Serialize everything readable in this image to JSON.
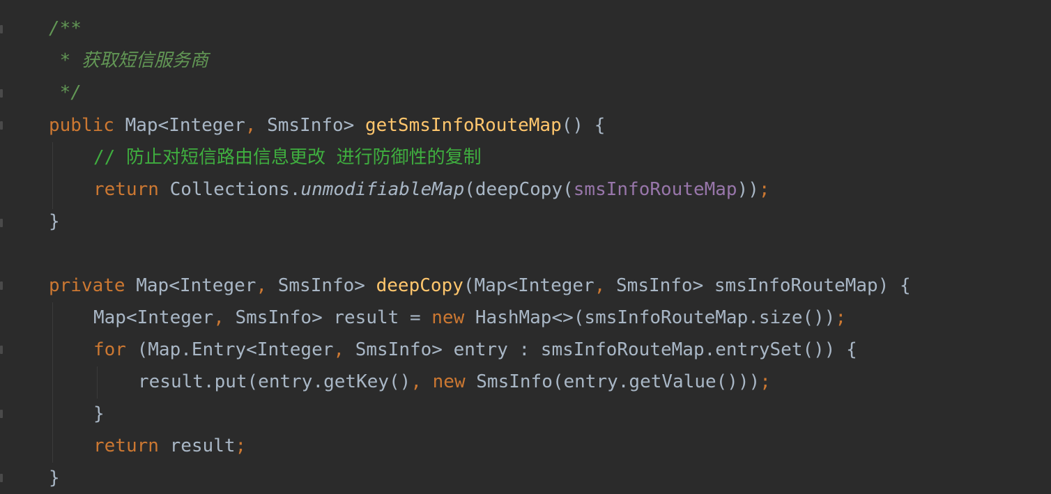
{
  "editor": {
    "lines": [
      {
        "segments": [
          {
            "text": "/**",
            "role": "doc-comment"
          }
        ]
      },
      {
        "segments": [
          {
            "text": " * 获取短信服务商",
            "role": "doc-comment"
          }
        ]
      },
      {
        "segments": [
          {
            "text": " */",
            "role": "doc-comment"
          }
        ]
      },
      {
        "segments": [
          {
            "text": "public",
            "role": "keyword"
          },
          {
            "text": " Map<Integer",
            "role": "plain"
          },
          {
            "text": ",",
            "role": "punct"
          },
          {
            "text": " SmsInfo> ",
            "role": "plain"
          },
          {
            "text": "getSmsInfoRouteMap",
            "role": "method"
          },
          {
            "text": "() {",
            "role": "plain"
          }
        ]
      },
      {
        "segments": [
          {
            "text": "// 防止对短信路由信息更改 进行防御性的复制",
            "role": "line-comment"
          }
        ]
      },
      {
        "segments": [
          {
            "text": "return",
            "role": "keyword"
          },
          {
            "text": " Collections.",
            "role": "plain"
          },
          {
            "text": "unmodifiableMap",
            "role": "static-call"
          },
          {
            "text": "(deepCopy(",
            "role": "plain"
          },
          {
            "text": "smsInfoRouteMap",
            "role": "field"
          },
          {
            "text": "))",
            "role": "plain"
          },
          {
            "text": ";",
            "role": "punct"
          }
        ]
      },
      {
        "segments": [
          {
            "text": "}",
            "role": "plain"
          }
        ]
      },
      {
        "segments": []
      },
      {
        "segments": [
          {
            "text": "private",
            "role": "keyword"
          },
          {
            "text": " Map<Integer",
            "role": "plain"
          },
          {
            "text": ",",
            "role": "punct"
          },
          {
            "text": " SmsInfo> ",
            "role": "plain"
          },
          {
            "text": "deepCopy",
            "role": "method"
          },
          {
            "text": "(Map<Integer",
            "role": "plain"
          },
          {
            "text": ",",
            "role": "punct"
          },
          {
            "text": " SmsInfo> smsInfoRouteMap) {",
            "role": "plain"
          }
        ]
      },
      {
        "segments": [
          {
            "text": "Map<Integer",
            "role": "plain"
          },
          {
            "text": ",",
            "role": "punct"
          },
          {
            "text": " SmsInfo> result = ",
            "role": "plain"
          },
          {
            "text": "new",
            "role": "keyword"
          },
          {
            "text": " HashMap<>(smsInfoRouteMap.size())",
            "role": "plain"
          },
          {
            "text": ";",
            "role": "punct"
          }
        ]
      },
      {
        "segments": [
          {
            "text": "for",
            "role": "keyword"
          },
          {
            "text": " (Map.Entry<Integer",
            "role": "plain"
          },
          {
            "text": ",",
            "role": "punct"
          },
          {
            "text": " SmsInfo> entry : smsInfoRouteMap.entrySet()) {",
            "role": "plain"
          }
        ]
      },
      {
        "segments": [
          {
            "text": "result.put(entry.getKey()",
            "role": "plain"
          },
          {
            "text": ",",
            "role": "punct"
          },
          {
            "text": " ",
            "role": "plain"
          },
          {
            "text": "new",
            "role": "keyword"
          },
          {
            "text": " SmsInfo(entry.getValue()))",
            "role": "plain"
          },
          {
            "text": ";",
            "role": "punct"
          }
        ]
      },
      {
        "segments": [
          {
            "text": "}",
            "role": "plain"
          }
        ]
      },
      {
        "segments": [
          {
            "text": "return",
            "role": "keyword"
          },
          {
            "text": " result",
            "role": "plain"
          },
          {
            "text": ";",
            "role": "punct"
          }
        ]
      },
      {
        "segments": [
          {
            "text": "}",
            "role": "plain"
          }
        ]
      }
    ]
  }
}
